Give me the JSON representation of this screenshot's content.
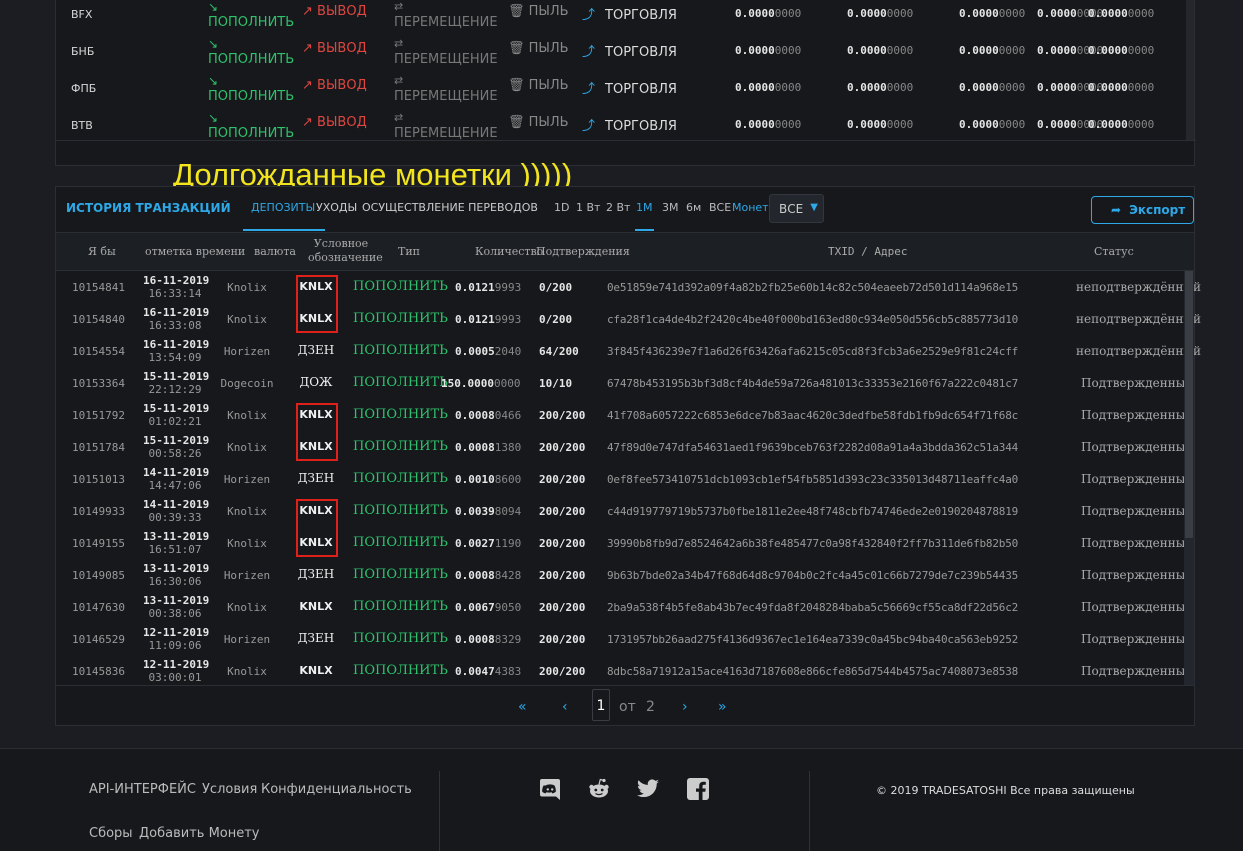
{
  "balances": {
    "labels": {
      "deposit": "ПОПОЛНИТЬ",
      "withdraw": "ВЫВОД",
      "transfer": "ПЕРЕМЕЩЕНИЕ",
      "dust": "ПЫЛЬ",
      "trade": "ТОРГОВЛЯ"
    },
    "rows": [
      {
        "name": "BFX",
        "v1": "0.0000",
        "v1b": "0000",
        "v2": "0.0000",
        "v2b": "0000",
        "v3": "0.0000",
        "v3b": "0000",
        "v4": "0.0000",
        "v4b": "0000",
        "v5": "0.0000",
        "v5b": "0000"
      },
      {
        "name": "БНБ",
        "v1": "0.0000",
        "v1b": "0000",
        "v2": "0.0000",
        "v2b": "0000",
        "v3": "0.0000",
        "v3b": "0000",
        "v4": "0.0000",
        "v4b": "0000",
        "v5": "0.0000",
        "v5b": "0000"
      },
      {
        "name": "ФПБ",
        "v1": "0.0000",
        "v1b": "0000",
        "v2": "0.0000",
        "v2b": "0000",
        "v3": "0.0000",
        "v3b": "0000",
        "v4": "0.0000",
        "v4b": "0000",
        "v5": "0.0000",
        "v5b": "0000"
      },
      {
        "name": "ВТВ",
        "v1": "0.0000",
        "v1b": "0000",
        "v2": "0.0000",
        "v2b": "0000",
        "v3": "0.0000",
        "v3b": "0000",
        "v4": "0.0000",
        "v4b": "0000",
        "v5": "0.0000",
        "v5b": "0000"
      }
    ]
  },
  "annotation": "Долгожданные монетки )))))",
  "history": {
    "title": "ИСТОРИЯ ТРАНЗАКЦИЙ",
    "tabs": [
      "ДЕПОЗИТЫ",
      "УХОДЫ",
      "ОСУЩЕСТВЛЕНИЕ ПЕРЕВОДОВ"
    ],
    "periods": [
      "1D",
      "1 Вт",
      "2 Вт",
      "1M",
      "3M",
      "6м",
      "ВСЕ"
    ],
    "coin_label": "Монета",
    "coin_value": "ВСЕ",
    "export": "Экспорт",
    "columns": {
      "id": "Я бы",
      "time": "отметка времени",
      "currency": "валюта",
      "symbol_l1": "Условное",
      "symbol_l2": "обозначение",
      "type": "Тип",
      "amount": "Количество",
      "conf": "Подтверждения",
      "txid": "TXID / Адрес",
      "status": "Статус"
    },
    "rows": [
      {
        "id": "10154841",
        "date": "16-11-2019",
        "time": "16:33:14",
        "currency": "Knolix",
        "symbol": "KNLX",
        "type": "ПОПОЛНИТЬ",
        "amt": "0.0121",
        "amt2": "9993",
        "conf": "0/200",
        "txid": "0e51859e741d392a09f4a82b2fb25e60b14c82c504eaeeb72d501d114a968e15",
        "status": "неподтверждённый"
      },
      {
        "id": "10154840",
        "date": "16-11-2019",
        "time": "16:33:08",
        "currency": "Knolix",
        "symbol": "KNLX",
        "type": "ПОПОЛНИТЬ",
        "amt": "0.0121",
        "amt2": "9993",
        "conf": "0/200",
        "txid": "cfa28f1ca4de4b2f2420c4be40f000bd163ed80c934e050d556cb5c885773d10",
        "status": "неподтверждённый"
      },
      {
        "id": "10154554",
        "date": "16-11-2019",
        "time": "13:54:09",
        "currency": "Horizen",
        "symbol": "ДЗЕН",
        "type": "ПОПОЛНИТЬ",
        "amt": "0.0005",
        "amt2": "2040",
        "conf": "64/200",
        "txid": "3f845f436239e7f1a6d26f63426afa6215c05cd8f3fcb3a6e2529e9f81c24cff",
        "status": "неподтверждённый"
      },
      {
        "id": "10153364",
        "date": "15-11-2019",
        "time": "22:12:29",
        "currency": "Dogecoin",
        "symbol": "ДОЖ",
        "type": "ПОПОЛНИТЬ",
        "amt": "150.0000",
        "amt2": "0000",
        "conf": "10/10",
        "txid": "67478b453195b3bf3d8cf4b4de59a726a481013c33353e2160f67a222c0481c7",
        "status": "Подтвержденный"
      },
      {
        "id": "10151792",
        "date": "15-11-2019",
        "time": "01:02:21",
        "currency": "Knolix",
        "symbol": "KNLX",
        "type": "ПОПОЛНИТЬ",
        "amt": "0.0008",
        "amt2": "0466",
        "conf": "200/200",
        "txid": "41f708a6057222c6853e6dce7b83aac4620c3dedfbe58fdb1fb9dc654f71f68c",
        "status": "Подтвержденный"
      },
      {
        "id": "10151784",
        "date": "15-11-2019",
        "time": "00:58:26",
        "currency": "Knolix",
        "symbol": "KNLX",
        "type": "ПОПОЛНИТЬ",
        "amt": "0.0008",
        "amt2": "1380",
        "conf": "200/200",
        "txid": "47f89d0e747dfa54631aed1f9639bceb763f2282d08a91a4a3bdda362c51a344",
        "status": "Подтвержденный"
      },
      {
        "id": "10151013",
        "date": "14-11-2019",
        "time": "14:47:06",
        "currency": "Horizen",
        "symbol": "ДЗЕН",
        "type": "ПОПОЛНИТЬ",
        "amt": "0.0010",
        "amt2": "8600",
        "conf": "200/200",
        "txid": "0ef8fee573410751dcb1093cb1ef54fb5851d393c23c335013d48711eaffc4a0",
        "status": "Подтвержденный"
      },
      {
        "id": "10149933",
        "date": "14-11-2019",
        "time": "00:39:33",
        "currency": "Knolix",
        "symbol": "KNLX",
        "type": "ПОПОЛНИТЬ",
        "amt": "0.0039",
        "amt2": "8094",
        "conf": "200/200",
        "txid": "c44d919779719b5737b0fbe1811e2ee48f748cbfb74746ede2e0190204878819",
        "status": "Подтвержденный"
      },
      {
        "id": "10149155",
        "date": "13-11-2019",
        "time": "16:51:07",
        "currency": "Knolix",
        "symbol": "KNLX",
        "type": "ПОПОЛНИТЬ",
        "amt": "0.0027",
        "amt2": "1190",
        "conf": "200/200",
        "txid": "39990b8fb9d7e8524642a6b38fe485477c0a98f432840f2ff7b311de6fb82b50",
        "status": "Подтвержденный"
      },
      {
        "id": "10149085",
        "date": "13-11-2019",
        "time": "16:30:06",
        "currency": "Horizen",
        "symbol": "ДЗЕН",
        "type": "ПОПОЛНИТЬ",
        "amt": "0.0008",
        "amt2": "8428",
        "conf": "200/200",
        "txid": "9b63b7bde02a34b47f68d64d8c9704b0c2fc4a45c01c66b7279de7c239b54435",
        "status": "Подтвержденный"
      },
      {
        "id": "10147630",
        "date": "13-11-2019",
        "time": "00:38:06",
        "currency": "Knolix",
        "symbol": "KNLX",
        "type": "ПОПОЛНИТЬ",
        "amt": "0.0067",
        "amt2": "9050",
        "conf": "200/200",
        "txid": "2ba9a538f4b5fe8ab43b7ec49fda8f2048284baba5c56669cf55ca8df22d56c2",
        "status": "Подтвержденный"
      },
      {
        "id": "10146529",
        "date": "12-11-2019",
        "time": "11:09:06",
        "currency": "Horizen",
        "symbol": "ДЗЕН",
        "type": "ПОПОЛНИТЬ",
        "amt": "0.0008",
        "amt2": "8329",
        "conf": "200/200",
        "txid": "1731957bb26aad275f4136d9367ec1e164ea7339c0a45bc94ba40ca563eb9252",
        "status": "Подтвержденный"
      },
      {
        "id": "10145836",
        "date": "12-11-2019",
        "time": "03:00:01",
        "currency": "Knolix",
        "symbol": "KNLX",
        "type": "ПОПОЛНИТЬ",
        "amt": "0.0047",
        "amt2": "4383",
        "conf": "200/200",
        "txid": "8dbc58a71912a15ace4163d7187608e866cfe865d7544b4575ac7408073e8538",
        "status": "Подтвержденный"
      }
    ],
    "pagination": {
      "current": "1",
      "of": "от",
      "total": "2"
    }
  },
  "footer": {
    "links_row1": [
      "API-ИНТЕРФЕЙС",
      "Условия",
      "Конфиденциальность"
    ],
    "links_row2": [
      "Сборы",
      "Добавить Монету"
    ],
    "social": [
      "discord-icon",
      "reddit-icon",
      "twitter-icon",
      "facebook-icon"
    ],
    "copyright": "© 2019 TRADESATOSHI Все права защищены"
  }
}
